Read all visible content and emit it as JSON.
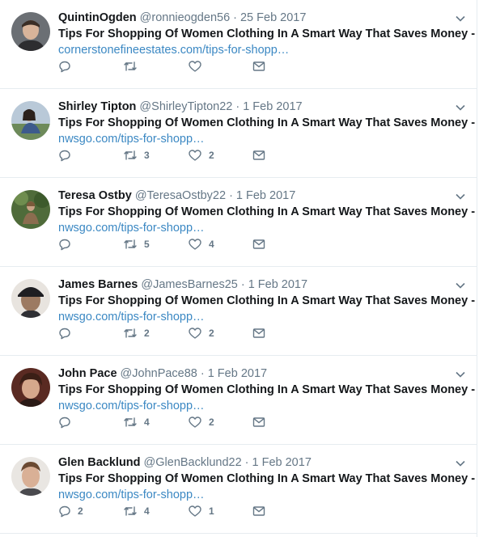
{
  "tweets": [
    {
      "name": "QuintinOgden",
      "handle": "@ronnieogden56",
      "sep": "·",
      "time": "25 Feb 2017",
      "text": "Tips For Shopping Of Women Clothing In A Smart Way That Saves Money -",
      "link": "cornerstonefineestates.com/tips-for-shopp…",
      "replies": "",
      "retweets": "",
      "likes": "",
      "avatar": "avatar-man-dark-hair"
    },
    {
      "name": "Shirley Tipton",
      "handle": "@ShirleyTipton22",
      "sep": "·",
      "time": "1 Feb 2017",
      "text": "Tips For Shopping Of Women Clothing In A Smart Way That Saves Money -",
      "link": "nwsgo.com/tips-for-shopp…",
      "replies": "",
      "retweets": "3",
      "likes": "2",
      "avatar": "avatar-woman-outdoors"
    },
    {
      "name": "Teresa Ostby",
      "handle": "@TeresaOstby22",
      "sep": "·",
      "time": "1 Feb 2017",
      "text": "Tips For Shopping Of Women Clothing In A Smart Way That Saves Money -",
      "link": "nwsgo.com/tips-for-shopp…",
      "replies": "",
      "retweets": "5",
      "likes": "4",
      "avatar": "avatar-woman-garden"
    },
    {
      "name": "James Barnes",
      "handle": "@JamesBarnes25",
      "sep": "·",
      "time": "1 Feb 2017",
      "text": "Tips For Shopping Of Women Clothing In A Smart Way That Saves Money -",
      "link": "nwsgo.com/tips-for-shopp…",
      "replies": "",
      "retweets": "2",
      "likes": "2",
      "avatar": "avatar-man-cap"
    },
    {
      "name": "John Pace",
      "handle": "@JohnPace88",
      "sep": "·",
      "time": "1 Feb 2017",
      "text": "Tips For Shopping Of Women Clothing In A Smart Way That Saves Money -",
      "link": "nwsgo.com/tips-for-shopp…",
      "replies": "",
      "retweets": "4",
      "likes": "2",
      "avatar": "avatar-man-dark-red"
    },
    {
      "name": "Glen Backlund",
      "handle": "@GlenBacklund22",
      "sep": "·",
      "time": "1 Feb 2017",
      "text": "Tips For Shopping Of Women Clothing In A Smart Way That Saves Money -",
      "link": "nwsgo.com/tips-for-shopp…",
      "replies": "2",
      "retweets": "4",
      "likes": "1",
      "avatar": "avatar-man-light"
    }
  ],
  "icons": {
    "reply": "reply-icon",
    "retweet": "retweet-icon",
    "like": "heart-icon",
    "dm": "envelope-icon",
    "caret": "chevron-down-icon"
  },
  "colors": {
    "text": "#14171a",
    "muted": "#657786",
    "link": "#3b88c3",
    "border": "#e6ecf0"
  }
}
